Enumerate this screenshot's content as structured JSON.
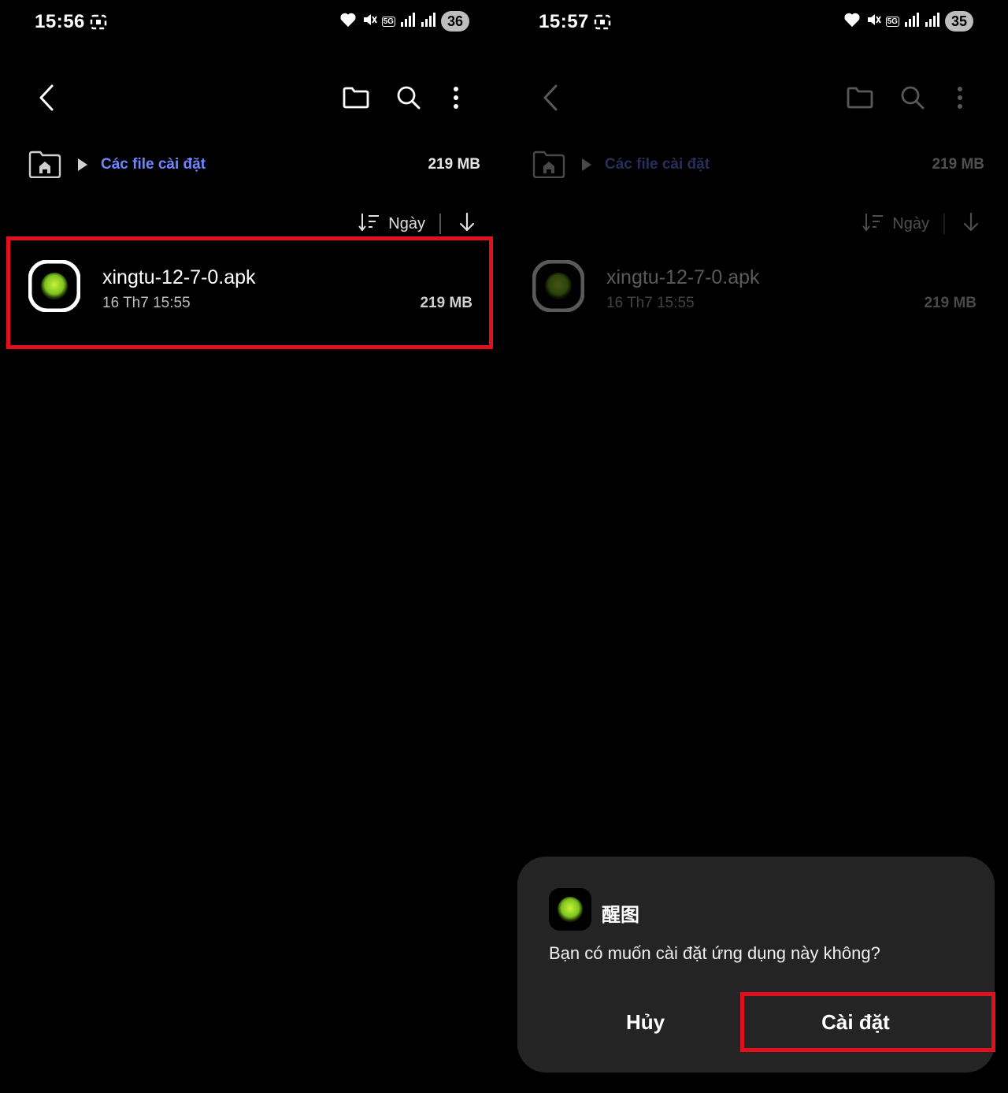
{
  "left_screen": {
    "status": {
      "time": "15:56",
      "battery": "36",
      "network": "5G"
    },
    "breadcrumb": {
      "label": "Các file cài đặt",
      "size": "219 MB"
    },
    "sort": {
      "label": "Ngày"
    },
    "file": {
      "name": "xingtu-12-7-0.apk",
      "date": "16 Th7 15:55",
      "size": "219 MB"
    }
  },
  "right_screen": {
    "status": {
      "time": "15:57",
      "battery": "35",
      "network": "5G"
    },
    "breadcrumb": {
      "label": "Các file cài đặt",
      "size": "219 MB"
    },
    "sort": {
      "label": "Ngày"
    },
    "file": {
      "name": "xingtu-12-7-0.apk",
      "date": "16 Th7 15:55",
      "size": "219 MB"
    },
    "dialog": {
      "app_name": "醒图",
      "question": "Bạn có muốn cài đặt ứng dụng này không?",
      "cancel_label": "Hủy",
      "install_label": "Cài đặt"
    }
  },
  "colors": {
    "accent": "#6f86ff",
    "highlight": "#e0101e",
    "app_green": "#a6e22e",
    "dialog_bg": "#242424"
  }
}
